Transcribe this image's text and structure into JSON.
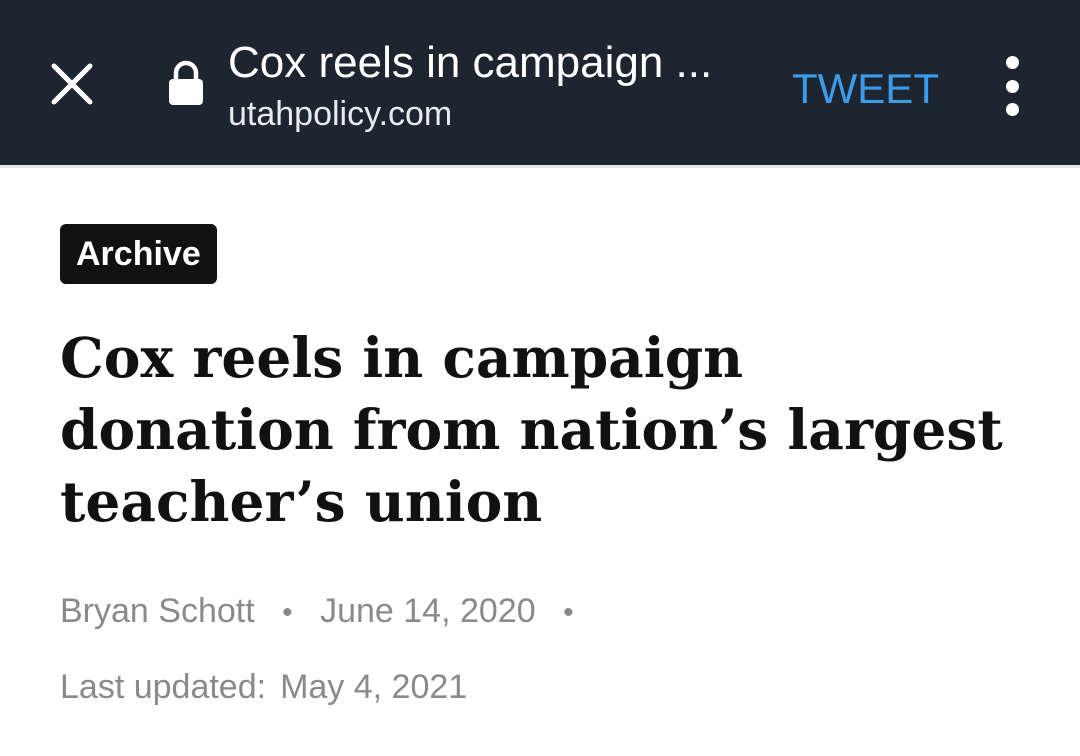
{
  "toolbar": {
    "title": "Cox reels in campaign ...",
    "domain": "utahpolicy.com",
    "tweet_label": "TWEET",
    "close_icon": "close-icon",
    "lock_icon": "lock-icon",
    "menu_icon": "more-vert-icon"
  },
  "article": {
    "badge": "Archive",
    "headline": "Cox reels in campaign donation from nation’s largest teacher’s union",
    "author": "Bryan Schott",
    "date": "June 14, 2020",
    "separator": "•",
    "updated_label": "Last updated:",
    "updated_date": "May 4, 2021"
  },
  "colors": {
    "toolbar_bg": "#1c2530",
    "tweet_accent": "#3d9be9",
    "meta_text": "#8a8a8a"
  }
}
